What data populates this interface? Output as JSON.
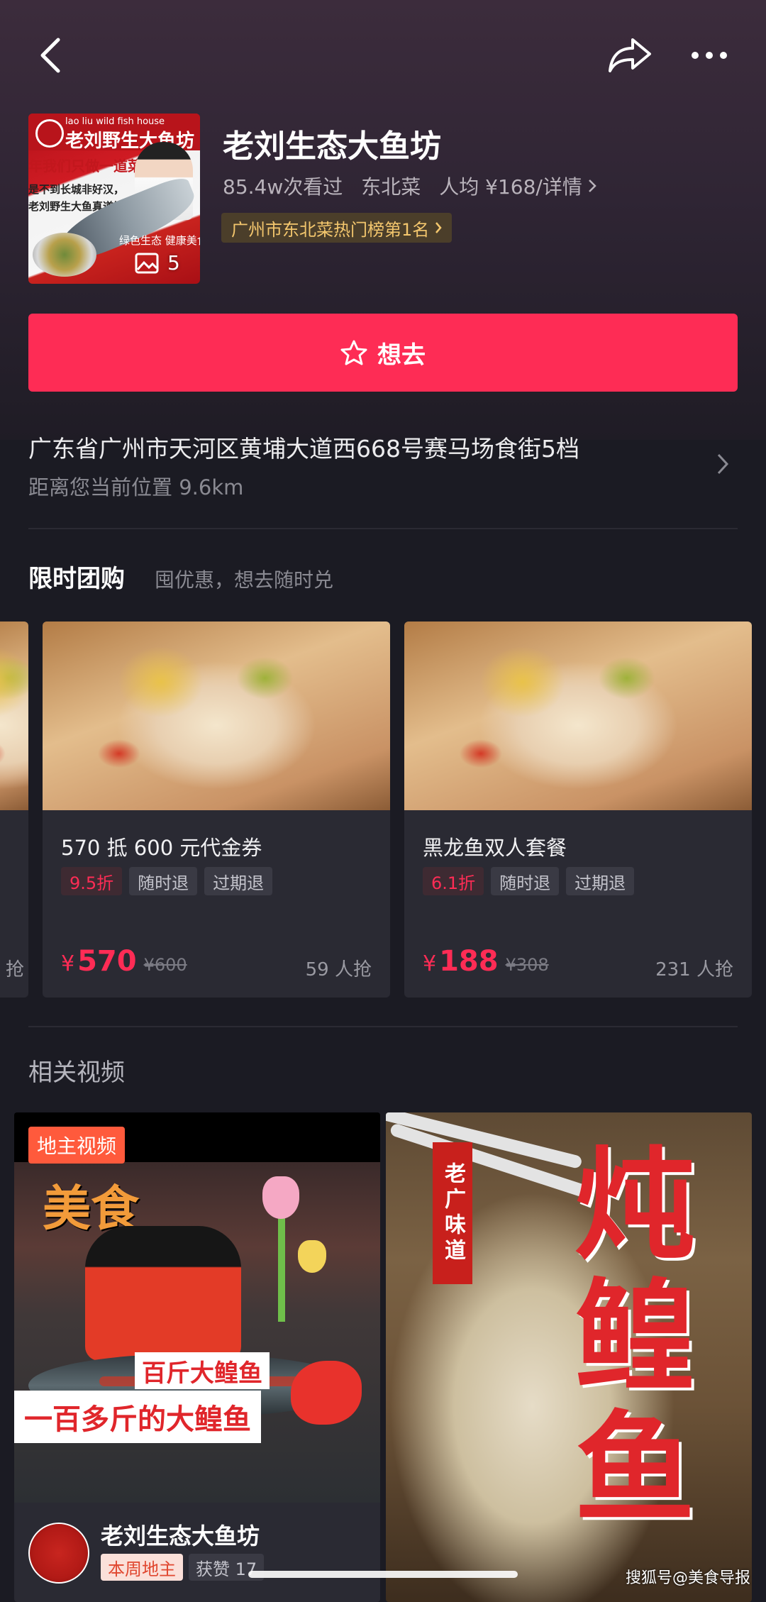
{
  "store": {
    "name": "老刘生态大鱼坊",
    "views": "85.4w次看过",
    "cuisine": "东北菜",
    "avg_price": "人均 ¥168/详情",
    "rank_badge": "广州市东北菜热门榜第1名",
    "image_count": "5",
    "thumb_logo_text": "老刘野生大鱼坊",
    "thumb_logo_en": "lao liu wild fish house",
    "thumb_line1": "年我们只做一道菜",
    "thumb_line2": "是不到长城非好汉，",
    "thumb_line3": "老刘野生大鱼真道镀",
    "thumb_line4": "绿色生态 健康美食"
  },
  "actions": {
    "want_label": "想去"
  },
  "address": {
    "text": "广东省广州市天河区黄埔大道西668号赛马场食街5档",
    "distance": "距离您当前位置 9.6km"
  },
  "group_buy": {
    "title": "限时团购",
    "subtitle": "囤优惠，想去随时兑",
    "deals": [
      {
        "title": "570 抵 600 元代金券",
        "discount": "9.5折",
        "tags": [
          "随时退",
          "过期退"
        ],
        "currency": "¥",
        "price": "570",
        "original": "¥600",
        "sold": "59 人抢"
      },
      {
        "title": "黑龙鱼双人套餐",
        "discount": "6.1折",
        "tags": [
          "随时退",
          "过期退"
        ],
        "currency": "¥",
        "price": "188",
        "original": "¥308",
        "sold": "231 人抢"
      }
    ],
    "peek_sold": "抢"
  },
  "videos": {
    "title": "相关视频",
    "items": [
      {
        "label": "地主视频",
        "overlay_title": "美食",
        "caption1": "百斤大鳇鱼",
        "caption2": "一百多斤的大鳇鱼",
        "author": "老刘生态大鱼坊",
        "badge": "本周地主",
        "likes": "获赞 17"
      },
      {
        "stamp": "老广味道",
        "big_text": "炖鳇鱼"
      }
    ]
  },
  "watermark": "搜狐号@美食导报",
  "colors": {
    "accent": "#fe2c55",
    "rank_gold": "#f3c66d",
    "background": "#1b1b23"
  },
  "icons": {
    "back": "chevron-left-icon",
    "share": "share-arrow-icon",
    "more": "more-dots-icon",
    "star": "star-outline-icon",
    "gallery": "image-gallery-icon",
    "chevron": "chevron-right-icon"
  }
}
